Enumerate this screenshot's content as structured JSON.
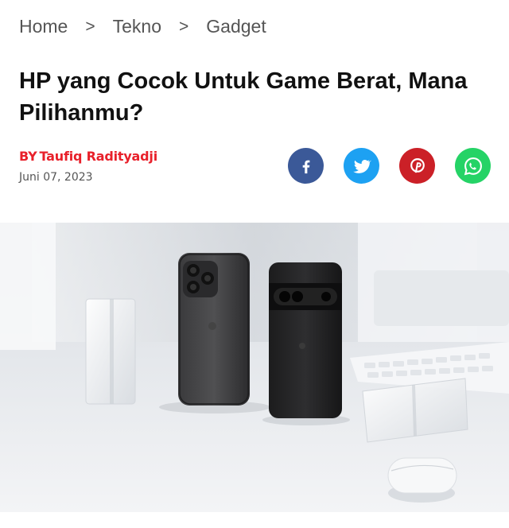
{
  "breadcrumb": {
    "items": [
      "Home",
      "Tekno",
      "Gadget"
    ],
    "separator": ">"
  },
  "article": {
    "title": "HP yang Cocok Untuk Game Berat, Mana Pilihanmu?",
    "author_prefix": "BY",
    "author": "Taufiq Radityadji",
    "date": "Juni 07, 2023"
  },
  "share": [
    {
      "name": "facebook",
      "icon": "facebook-icon",
      "color": "#3b5998"
    },
    {
      "name": "twitter",
      "icon": "twitter-icon",
      "color": "#1da1f2"
    },
    {
      "name": "pinterest",
      "icon": "pinterest-icon",
      "color": "#cb2027"
    },
    {
      "name": "whatsapp",
      "icon": "whatsapp-icon",
      "color": "#25d366"
    }
  ],
  "colors": {
    "author": "#e8202a",
    "muted": "#555555",
    "title": "#111111"
  }
}
